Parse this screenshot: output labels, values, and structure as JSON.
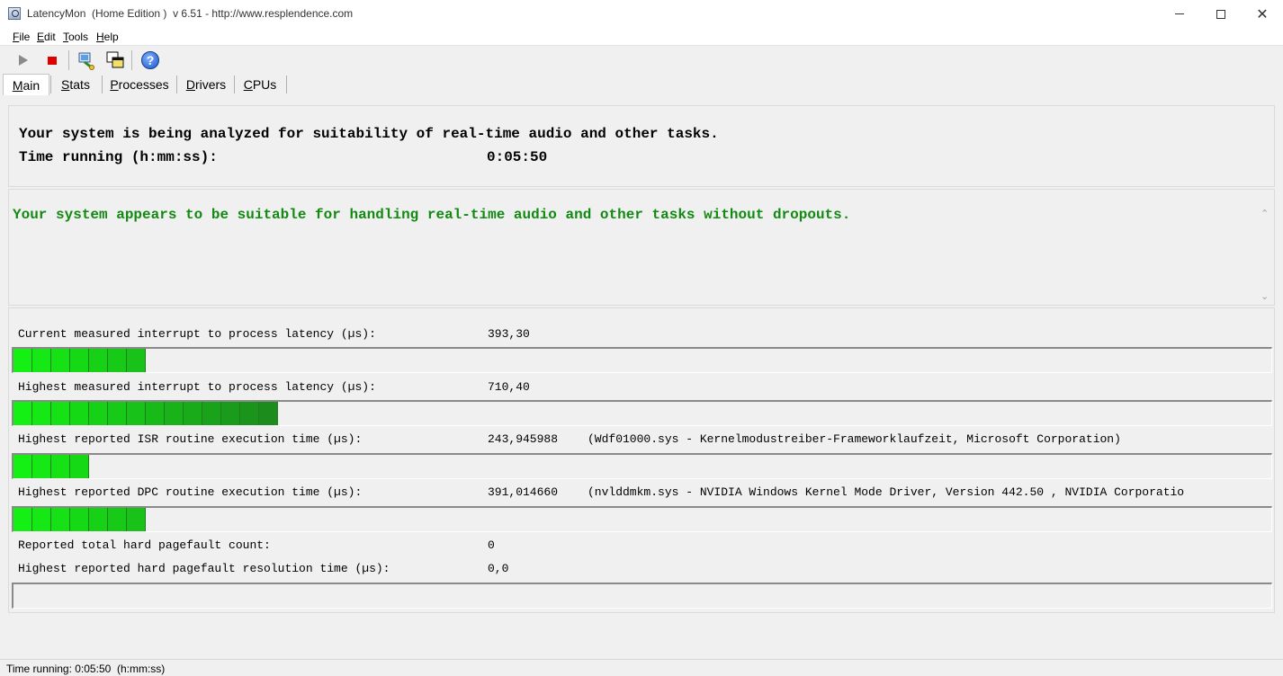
{
  "window": {
    "title": "LatencyMon  (Home Edition )  v 6.51 - http://www.resplendence.com",
    "minimize_glyph": "",
    "close_glyph": "✕"
  },
  "menu": [
    {
      "label": "File",
      "accel": "F",
      "rest": "ile"
    },
    {
      "label": "Edit",
      "accel": "E",
      "rest": "dit"
    },
    {
      "label": "Tools",
      "accel": "T",
      "rest": "ools"
    },
    {
      "label": "Help",
      "accel": "H",
      "rest": "elp"
    }
  ],
  "toolbar": {
    "icons": [
      "play-icon",
      "stop-icon",
      "drivers-icon",
      "windows-icon",
      "help-icon"
    ],
    "help_glyph": "?"
  },
  "tabs": [
    {
      "label": "Main",
      "accel": "M",
      "rest": "ain",
      "active": true
    },
    {
      "label": "Stats",
      "accel": "S",
      "rest": "tats",
      "active": false
    },
    {
      "label": "Processes",
      "accel": "P",
      "rest": "rocesses",
      "active": false
    },
    {
      "label": "Drivers",
      "accel": "D",
      "rest": "rivers",
      "active": false
    },
    {
      "label": "CPUs",
      "accel": "C",
      "rest": "PUs",
      "active": false
    }
  ],
  "summary": {
    "analyzing_text": "Your system is being analyzed for suitability of real-time audio and other tasks.",
    "time_label": "Time running (h:mm:ss):",
    "time_value": "0:05:50"
  },
  "verdict": {
    "text": "Your system appears to be suitable for handling real-time audio and other tasks without dropouts.",
    "color": "#118a11",
    "scroll_up_glyph": "⌃",
    "scroll_down_glyph": "⌄"
  },
  "metrics": {
    "current_latency": {
      "label": "Current measured interrupt to process latency (µs):",
      "value": "393,30",
      "bar_segments": 7
    },
    "highest_latency": {
      "label": "Highest measured interrupt to process latency (µs):",
      "value": "710,40",
      "bar_segments": 14
    },
    "isr": {
      "label": "Highest reported ISR routine execution time (µs):",
      "value": "243,945988",
      "detail": "(Wdf01000.sys - Kernelmodustreiber-Frameworklaufzeit, Microsoft Corporation)",
      "bar_segments": 4
    },
    "dpc": {
      "label": "Highest reported DPC routine execution time (µs):",
      "value": "391,014660",
      "detail": "(nvlddmkm.sys - NVIDIA Windows Kernel Mode Driver, Version 442.50 , NVIDIA Corporatio",
      "bar_segments": 7
    },
    "pagefault_count": {
      "label": "Reported total hard pagefault count:",
      "value": "0"
    },
    "pagefault_time": {
      "label": "Highest reported hard pagefault resolution time (µs):",
      "value": "0,0",
      "bar_segments": 0
    },
    "bar_colors": {
      "bright": "#14f014",
      "dark": "#1c8c1c"
    }
  },
  "statusbar": {
    "text": "Time running: 0:05:50  (h:mm:ss)"
  }
}
